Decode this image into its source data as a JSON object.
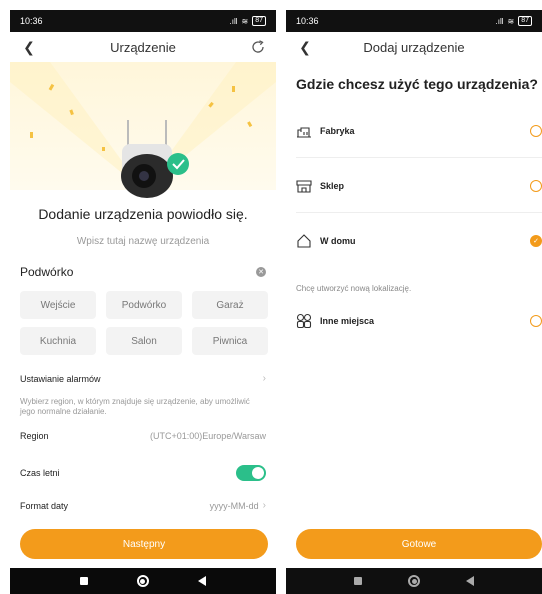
{
  "left": {
    "status": {
      "time": "10:36",
      "signal": ".ıll",
      "wifi": "≋",
      "battery": "87"
    },
    "header": {
      "title": "Urządzenie"
    },
    "success_title": "Dodanie urządzenia powiodło się.",
    "name_hint": "Wpisz tutaj nazwę urządzenia",
    "name_value": "Podwórko",
    "chips": [
      "Wejście",
      "Podwórko",
      "Garaż",
      "Kuchnia",
      "Salon",
      "Piwnica"
    ],
    "alarm_label": "Ustawianie alarmów",
    "region_desc": "Wybierz region, w którym znajduje się urządzenie, aby umożliwić jego normalne działanie.",
    "region_label": "Region",
    "region_value": "(UTC+01:00)Europe/Warsaw",
    "dst_label": "Czas letni",
    "dst_on": true,
    "date_format_label": "Format daty",
    "date_format_value": "yyyy-MM-dd",
    "next_button": "Następny"
  },
  "right": {
    "status": {
      "time": "10:36",
      "signal": ".ıll",
      "wifi": "≋",
      "battery": "87"
    },
    "header": {
      "title": "Dodaj urządzenie"
    },
    "question": "Gdzie chcesz użyć tego urządzenia?",
    "locations": [
      {
        "label": "Fabryka",
        "icon": "factory-icon",
        "selected": false
      },
      {
        "label": "Sklep",
        "icon": "shop-icon",
        "selected": false
      },
      {
        "label": "W domu",
        "icon": "home-icon",
        "selected": true
      }
    ],
    "new_location_hint": "Chcę utworzyć nową lokalizację.",
    "other_location": {
      "label": "Inne miejsca",
      "icon": "grid-icon",
      "selected": false
    },
    "done_button": "Gotowe"
  },
  "colors": {
    "accent": "#f39b1b",
    "toggle_on": "#2bbf8a",
    "hero_bg": "#fff6da"
  }
}
